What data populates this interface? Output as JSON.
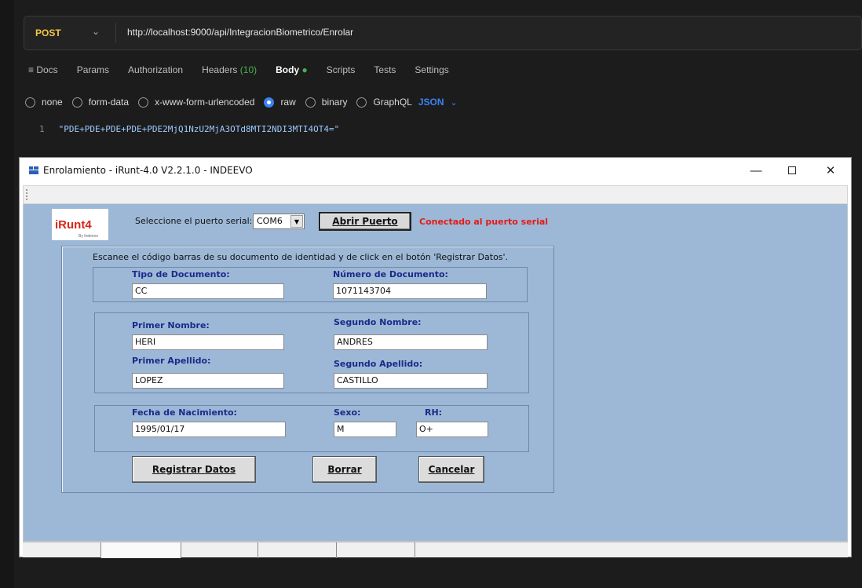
{
  "postman": {
    "method": "POST",
    "url": "http://localhost:9000/api/IntegracionBiometrico/Enrolar",
    "tabs": {
      "docs": "≡ Docs",
      "params": "Params",
      "authorization": "Authorization",
      "headers": "Headers",
      "headers_count": "(10)",
      "body": "Body",
      "body_dot": "●",
      "scripts": "Scripts",
      "tests": "Tests",
      "settings": "Settings"
    },
    "body_options": {
      "none": "none",
      "form_data": "form-data",
      "urlencoded": "x-www-form-urlencoded",
      "raw": "raw",
      "binary": "binary",
      "graphql": "GraphQL",
      "format": "JSON"
    },
    "code_line_number": "1",
    "code_line": "\"PDE+PDE+PDE+PDE+PDE2MjQ1NzU2MjA3OTd8MTI2NDI3MTI4OT4=\""
  },
  "dialog": {
    "title": "Enrolamiento - iRunt-4.0 V2.2.1.0 - INDEEVO",
    "logo_text": "iRunt4",
    "logo_subtext": "By Indeevo",
    "port_label": "Seleccione el puerto serial:",
    "port_value": "COM6",
    "open_port_button": "Abrir Puerto",
    "status_text": "Conectado al puerto serial",
    "instruction": "Escanee el código barras de su documento de identidad y de click en el botón 'Registrar Datos'.",
    "fields": {
      "tipo_documento": {
        "label": "Tipo de Documento:",
        "value": "CC"
      },
      "numero_documento": {
        "label": "Número de Documento:",
        "value": "1071143704"
      },
      "primer_nombre": {
        "label": "Primer Nombre:",
        "value": "HERI"
      },
      "segundo_nombre": {
        "label": "Segundo Nombre:",
        "value": "ANDRES"
      },
      "primer_apellido": {
        "label": "Primer Apellido:",
        "value": "LOPEZ"
      },
      "segundo_apellido": {
        "label": "Segundo Apellido:",
        "value": "CASTILLO"
      },
      "fecha_nacimiento": {
        "label": "Fecha de Nacimiento:",
        "value": "1995/01/17"
      },
      "sexo": {
        "label": "Sexo:",
        "value": "M"
      },
      "rh": {
        "label": "RH:",
        "value": "O+"
      }
    },
    "buttons": {
      "register": "Registrar Datos",
      "clear": "Borrar",
      "cancel": "Cancelar"
    }
  },
  "colors": {
    "client_bg": "#9cb8d6",
    "label_blue": "#1a2a8a",
    "status_red": "#e41b17",
    "method_yellow": "#f5c842",
    "accent_blue": "#3b82f6"
  }
}
